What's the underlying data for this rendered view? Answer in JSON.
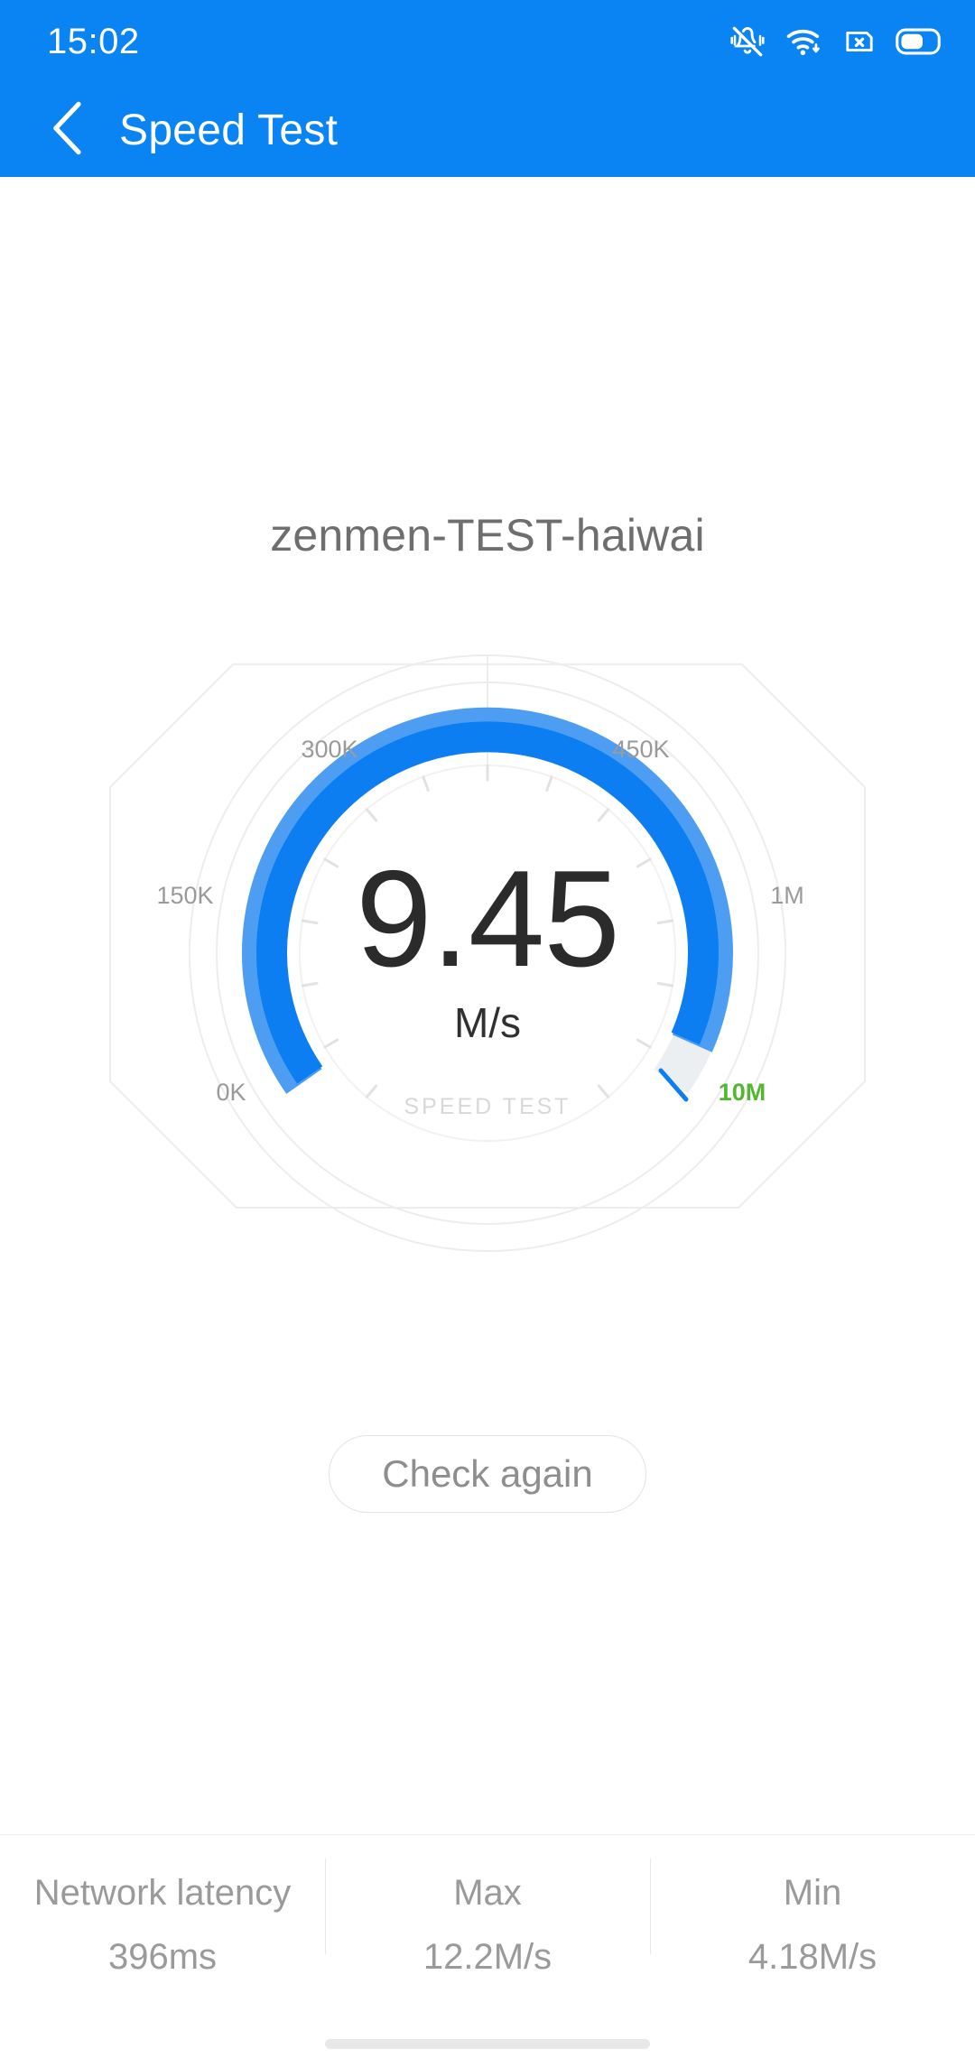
{
  "status_bar": {
    "time": "15:02",
    "icons": [
      "vibrate-off-icon",
      "wifi-icon",
      "sim-card-icon",
      "battery-icon"
    ]
  },
  "app_bar": {
    "back_icon": "chevron-left-icon",
    "title": "Speed Test"
  },
  "main": {
    "ssid": "zenmen-TEST-haiwai",
    "check_again_label": "Check again"
  },
  "chart_data": {
    "type": "gauge",
    "title": "SPEED TEST",
    "value": "9.45",
    "unit": "M/s",
    "value_numeric": 9.45,
    "tick_labels": [
      "0K",
      "150K",
      "300K",
      "450K",
      "1M",
      "10M"
    ],
    "scale_min_label": "0K",
    "scale_max_label": "10M",
    "highlight_label": "10M",
    "highlight_color": "#52b832",
    "arc_start_deg": 145,
    "arc_sweep_deg": 250,
    "filled_fraction": 0.955,
    "arc_color_inner": "#0d7ef2",
    "arc_color_outer": "#4d9ef2",
    "arc_track_color": "#eceff1",
    "tick_color": "#e8e8e8",
    "label_color": "#9a9a9a"
  },
  "stats": {
    "columns": [
      {
        "label": "Network latency",
        "value": "396ms"
      },
      {
        "label": "Max",
        "value": "12.2M/s"
      },
      {
        "label": "Min",
        "value": "4.18M/s"
      }
    ]
  },
  "colors": {
    "header_blue": "#0a84f2",
    "accent_green": "#52b832",
    "text_gray": "#9a9a9a"
  }
}
